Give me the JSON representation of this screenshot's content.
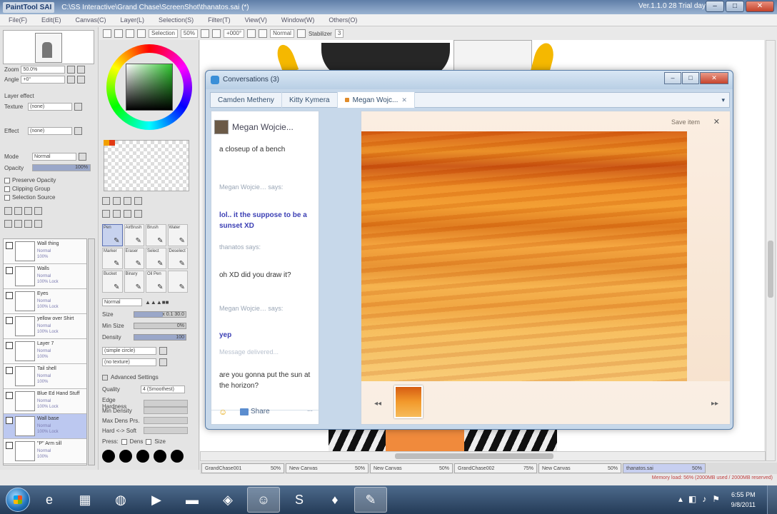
{
  "sai": {
    "logo": "PaintTool SAI",
    "title": "C:\\SS Interactive\\Grand Chase\\ScreenShot\\thanatos.sai (*)",
    "version": "Ver.1.1.0 28 Trial day",
    "menu": [
      "File(F)",
      "Edit(E)",
      "Canvas(C)",
      "Layer(L)",
      "Selection(S)",
      "Filter(T)",
      "View(V)",
      "Window(W)",
      "Others(O)"
    ],
    "toolbar": {
      "selection_label": "Selection",
      "zoom_value": "50%",
      "rotation_value": "+000°",
      "normal_label": "Normal",
      "stabilizer_label": "Stabilizer",
      "stabilizer_value": "3"
    }
  },
  "left_panel": {
    "zoom_label": "Zoom",
    "zoom_value": "50.0%",
    "angle_label": "Angle",
    "angle_value": "+0°",
    "paper_effect": "Layer effect",
    "texture_label": "Texture",
    "texture_value": "(none)",
    "effect_label": "Effect",
    "effect_value": "(none)",
    "mode_label": "Mode",
    "mode_value": "Normal",
    "opacity_label": "Opacity",
    "opacity_value": "100%",
    "opacity_level": 1.0,
    "preserve_opacity": "Preserve Opacity",
    "clipping_group": "Clipping Group",
    "selection_source": "Selection Source"
  },
  "layers": [
    {
      "name": "Wall thing",
      "mode": "Normal",
      "opacity": "100%",
      "selected": false
    },
    {
      "name": "Walls",
      "mode": "Normal",
      "opacity": "100% Lock",
      "selected": false
    },
    {
      "name": "Eyes",
      "mode": "Normal",
      "opacity": "100% Lock",
      "selected": false
    },
    {
      "name": "yellow over Shirt",
      "mode": "Normal",
      "opacity": "100% Lock",
      "selected": false
    },
    {
      "name": "Layer 7",
      "mode": "Normal",
      "opacity": "100%",
      "selected": false
    },
    {
      "name": "Tail shell",
      "mode": "Normal",
      "opacity": "100%",
      "selected": false
    },
    {
      "name": "Blue Ed Hand Stuff",
      "mode": "Normal",
      "opacity": "100% Lock",
      "selected": false
    },
    {
      "name": "Wall base",
      "mode": "Normal",
      "opacity": "100% Lock",
      "selected": true
    },
    {
      "name": "\"P\" Arm sill",
      "mode": "Normal",
      "opacity": "100%",
      "selected": false
    }
  ],
  "tools": [
    {
      "label": "Pen",
      "active": true
    },
    {
      "label": "AirBrush",
      "active": false
    },
    {
      "label": "Brush",
      "active": false
    },
    {
      "label": "Water",
      "active": false
    },
    {
      "label": "Marker",
      "active": false
    },
    {
      "label": "Eraser",
      "active": false
    },
    {
      "label": "Select",
      "active": false
    },
    {
      "label": "Deselect",
      "active": false
    },
    {
      "label": "Bucket",
      "active": false
    },
    {
      "label": "Binary",
      "active": false
    },
    {
      "label": "Oil Pen",
      "active": false
    },
    {
      "label": "",
      "active": false
    }
  ],
  "tool_props": {
    "mode_value": "Normal",
    "size_label": "Size",
    "size_value": "x 0.1 30.0",
    "size_level": 0.55,
    "min_size_label": "Min Size",
    "min_size_value": "0%",
    "min_size_level": 0.0,
    "density_label": "Density",
    "density_value": "100",
    "density_level": 1.0,
    "shape_value": "(simple circle)",
    "texture_value": "(no texture)",
    "advanced_label": "Advanced Settings",
    "quality_label": "Quality",
    "quality_value": "4 (Smoothest)",
    "edge_label": "Edge Hardness",
    "min_density_label": "Min Density",
    "max_dens_label": "Max Dens Prs.",
    "hard_soft_label": "Hard <-> Soft",
    "press_label": "Press:",
    "dens_label": "Dens",
    "size2_label": "Size"
  },
  "conversation": {
    "window_title": "Conversations (3)",
    "min_label": "–",
    "max_label": "□",
    "close_label": "✕",
    "tabs": [
      {
        "label": "Camden Metheny",
        "active": false
      },
      {
        "label": "Kitty Kymera",
        "active": false
      },
      {
        "label": "Megan Wojc...",
        "active": true
      }
    ],
    "tabs_menu": "▾",
    "contact_name": "Megan Wojcie...",
    "messages": [
      {
        "kind": "text",
        "text": "a closeup of a bench"
      },
      {
        "kind": "sender",
        "text": "Megan Wojcie… says:"
      },
      {
        "kind": "mine",
        "text": "lol.. it the suppose to be a sunset XD"
      },
      {
        "kind": "sender",
        "text": "thanatos says:"
      },
      {
        "kind": "text",
        "text": "oh XD did you draw it?"
      },
      {
        "kind": "sender",
        "text": "Megan Wojcie… says:"
      },
      {
        "kind": "mine",
        "text": "yep"
      },
      {
        "kind": "faded",
        "text": "Message delivered..."
      },
      {
        "kind": "text",
        "text": "are you gonna put the sun at the horizon?"
      }
    ],
    "share_label": "Share",
    "more_label": "···",
    "save_label": "Save item",
    "photo_close": "✕",
    "prev_label": "◂◂",
    "next_label": "▸▸"
  },
  "doc_tabs": [
    {
      "name": "GrandChase001",
      "zoom": "50%",
      "active": false
    },
    {
      "name": "New Canvas",
      "zoom": "50%",
      "active": false
    },
    {
      "name": "New Canvas",
      "zoom": "50%",
      "active": false
    },
    {
      "name": "GrandChase002",
      "zoom": "75%",
      "active": false
    },
    {
      "name": "New Canvas",
      "zoom": "50%",
      "active": false
    },
    {
      "name": "thanatos.sai",
      "zoom": "50%",
      "active": true
    }
  ],
  "status_text": "Memory load: 56% (2000MB used / 2000MB reserved)",
  "taskbar": {
    "apps": [
      {
        "icon": "ie-icon",
        "glyph": "e",
        "active": false
      },
      {
        "icon": "calculator-icon",
        "glyph": "▦",
        "active": false
      },
      {
        "icon": "globe-icon",
        "glyph": "◍",
        "active": false
      },
      {
        "icon": "media-player-icon",
        "glyph": "▶",
        "active": false
      },
      {
        "icon": "folder-icon",
        "glyph": "▬",
        "active": false
      },
      {
        "icon": "network-icon",
        "glyph": "◈",
        "active": false
      },
      {
        "icon": "messenger-icon",
        "glyph": "☺",
        "active": true
      },
      {
        "icon": "skype-icon",
        "glyph": "S",
        "active": false
      },
      {
        "icon": "game-icon",
        "glyph": "♦",
        "active": false
      },
      {
        "icon": "sai-icon",
        "glyph": "✎",
        "active": true
      }
    ],
    "time": "6:55 PM",
    "date": "9/8/2011"
  }
}
